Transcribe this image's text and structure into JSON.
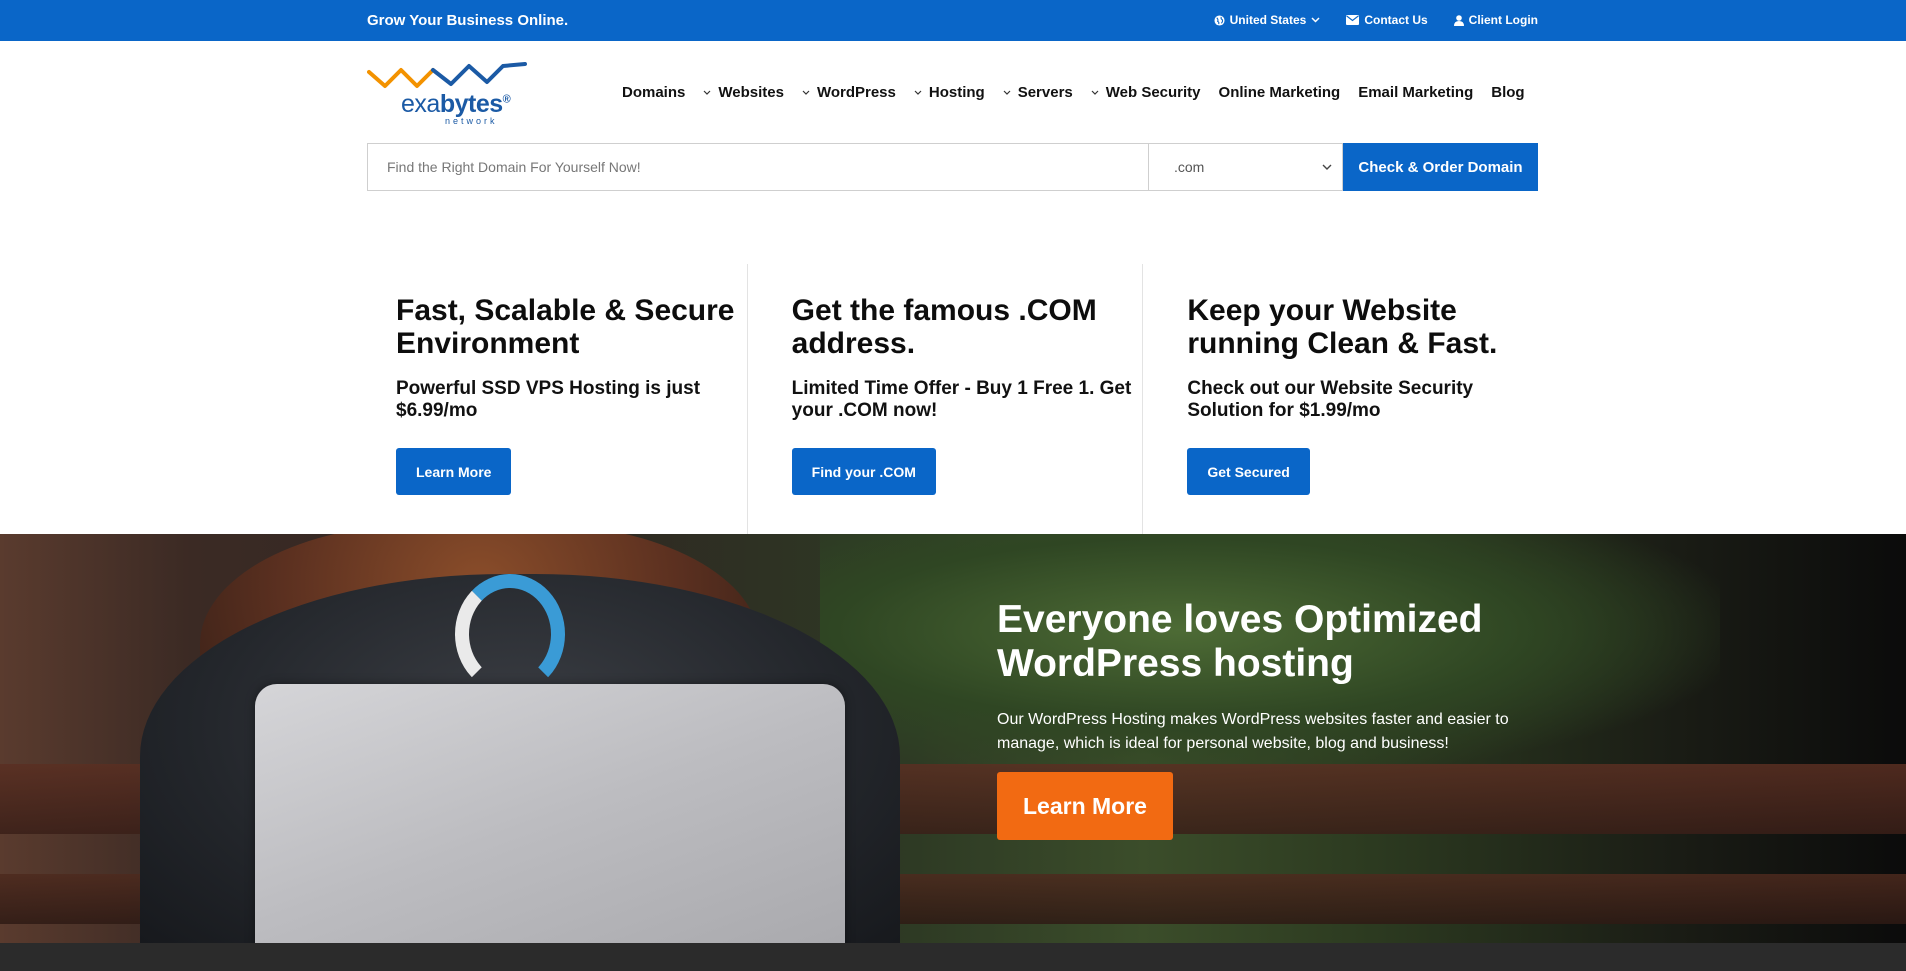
{
  "topbar": {
    "tagline": "Grow Your Business Online.",
    "country": "United States",
    "contact": "Contact Us",
    "login": "Client Login"
  },
  "logo": {
    "word_exa": "exa",
    "word_bytes": "bytes",
    "reg": "®",
    "sub": "network"
  },
  "nav": {
    "items": [
      {
        "label": "Domains",
        "dropdown": false
      },
      {
        "label": "Websites",
        "dropdown": true
      },
      {
        "label": "WordPress",
        "dropdown": true
      },
      {
        "label": "Hosting",
        "dropdown": true
      },
      {
        "label": "Servers",
        "dropdown": true
      },
      {
        "label": "Web Security",
        "dropdown": true
      },
      {
        "label": "Online Marketing",
        "dropdown": false
      },
      {
        "label": "Email Marketing",
        "dropdown": false
      },
      {
        "label": "Blog",
        "dropdown": false
      }
    ]
  },
  "search": {
    "placeholder": "Find the Right Domain For Yourself Now!",
    "tld": ".com",
    "button": "Check & Order Domain"
  },
  "features": [
    {
      "title": "Fast, Scalable & Secure Environment",
      "text": "Powerful SSD VPS Hosting is just $6.99/mo",
      "button": "Learn More"
    },
    {
      "title": "Get the famous .COM address.",
      "text": "Limited Time Offer - Buy 1 Free 1. Get your .COM now!",
      "button": "Find your .COM"
    },
    {
      "title": "Keep your Website running Clean & Fast.",
      "text": "Check out our Website Security Solution for $1.99/mo",
      "button": "Get Secured"
    }
  ],
  "hero": {
    "title": "Everyone loves Optimized WordPress hosting",
    "text": "Our WordPress Hosting makes WordPress websites faster and easier to manage, which is ideal for personal website, blog and business!",
    "button": "Learn More"
  },
  "colors": {
    "brand_blue": "#0a66c8",
    "cta_orange": "#f26a12",
    "logo_orange": "#f39200",
    "logo_blue": "#1b5aa5"
  }
}
